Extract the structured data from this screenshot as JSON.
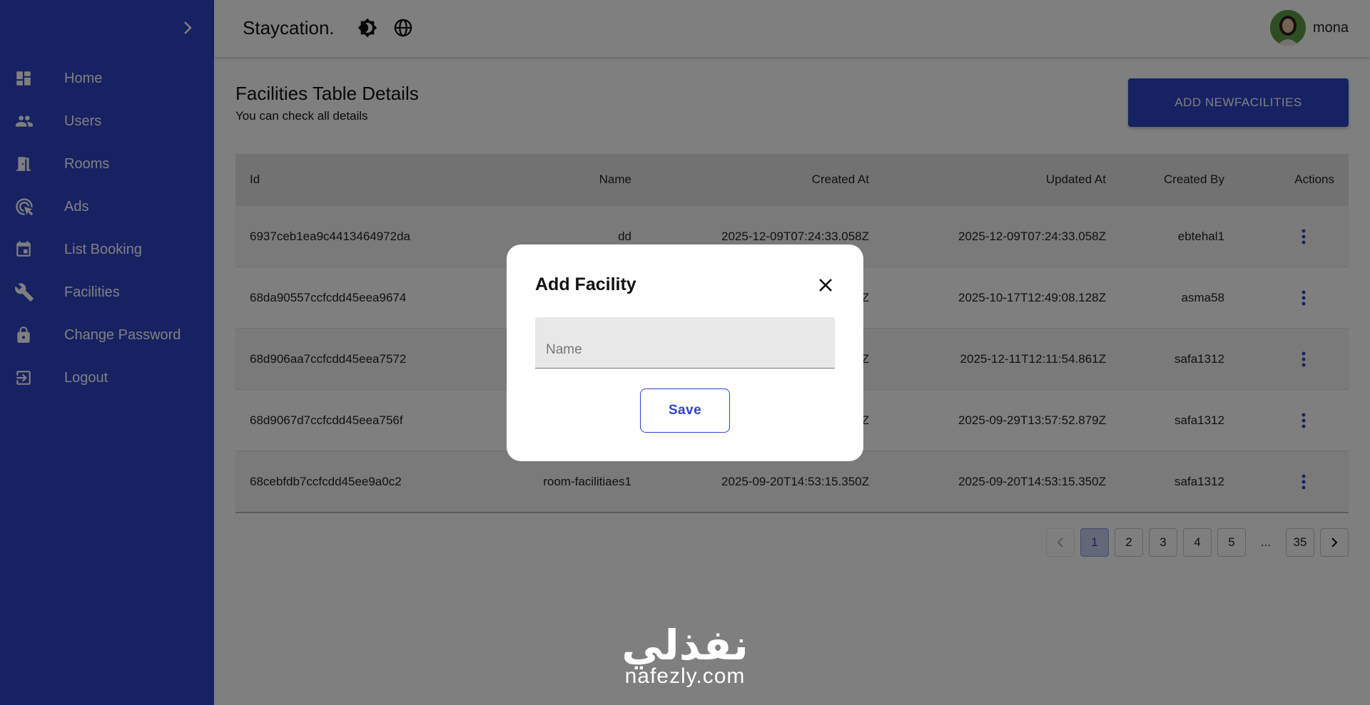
{
  "colors": {
    "primary": "#2f45c7",
    "overlay": "rgba(0,0,0,0.5)"
  },
  "header": {
    "brand": "Staycation.",
    "user_name": "mona",
    "icons": [
      "theme-toggle-icon",
      "globe-icon"
    ]
  },
  "sidebar": {
    "items": [
      {
        "label": "Home",
        "icon": "dashboard-icon"
      },
      {
        "label": "Users",
        "icon": "users-icon"
      },
      {
        "label": "Rooms",
        "icon": "door-icon"
      },
      {
        "label": "Ads",
        "icon": "ads-icon"
      },
      {
        "label": "List Booking",
        "icon": "calendar-icon"
      },
      {
        "label": "Facilities",
        "icon": "wrench-icon"
      },
      {
        "label": "Change Password",
        "icon": "lock-icon"
      },
      {
        "label": "Logout",
        "icon": "logout-icon"
      }
    ]
  },
  "main": {
    "title": "Facilities Table Details",
    "subtitle": "You can check all details",
    "add_button": "ADD NEWFACILITIES"
  },
  "table": {
    "headers": [
      "Id",
      "Name",
      "Created At",
      "Updated At",
      "Created By",
      "Actions"
    ],
    "rows": [
      {
        "id": "6937ceb1ea9c4413464972da",
        "name": "dd",
        "created_at": "2025-12-09T07:24:33.058Z",
        "updated_at": "2025-12-09T07:24:33.058Z",
        "created_by": "ebtehal1"
      },
      {
        "id": "68da90557ccfcdd45eea9674",
        "name": "",
        "created_at": "Z",
        "updated_at": "2025-10-17T12:49:08.128Z",
        "created_by": "asma58"
      },
      {
        "id": "68d906aa7ccfcdd45eea7572",
        "name": "",
        "created_at": "Z",
        "updated_at": "2025-12-11T12:11:54.861Z",
        "created_by": "safa1312"
      },
      {
        "id": "68d9067d7ccfcdd45eea756f",
        "name": "",
        "created_at": "Z",
        "updated_at": "2025-09-29T13:57:52.879Z",
        "created_by": "safa1312"
      },
      {
        "id": "68cebfdb7ccfcdd45ee9a0c2",
        "name": "room-facilitiaes1",
        "created_at": "2025-09-20T14:53:15.350Z",
        "updated_at": "2025-09-20T14:53:15.350Z",
        "created_by": "safa1312"
      }
    ]
  },
  "pagination": {
    "pages": [
      "1",
      "2",
      "3",
      "4",
      "5",
      "...",
      "35"
    ],
    "current": "1"
  },
  "watermark": {
    "arabic": "نفذلي",
    "latin": "nafezly.com"
  },
  "modal": {
    "title": "Add Facility",
    "field_placeholder": "Name",
    "field_value": "",
    "save_label": "Save"
  }
}
